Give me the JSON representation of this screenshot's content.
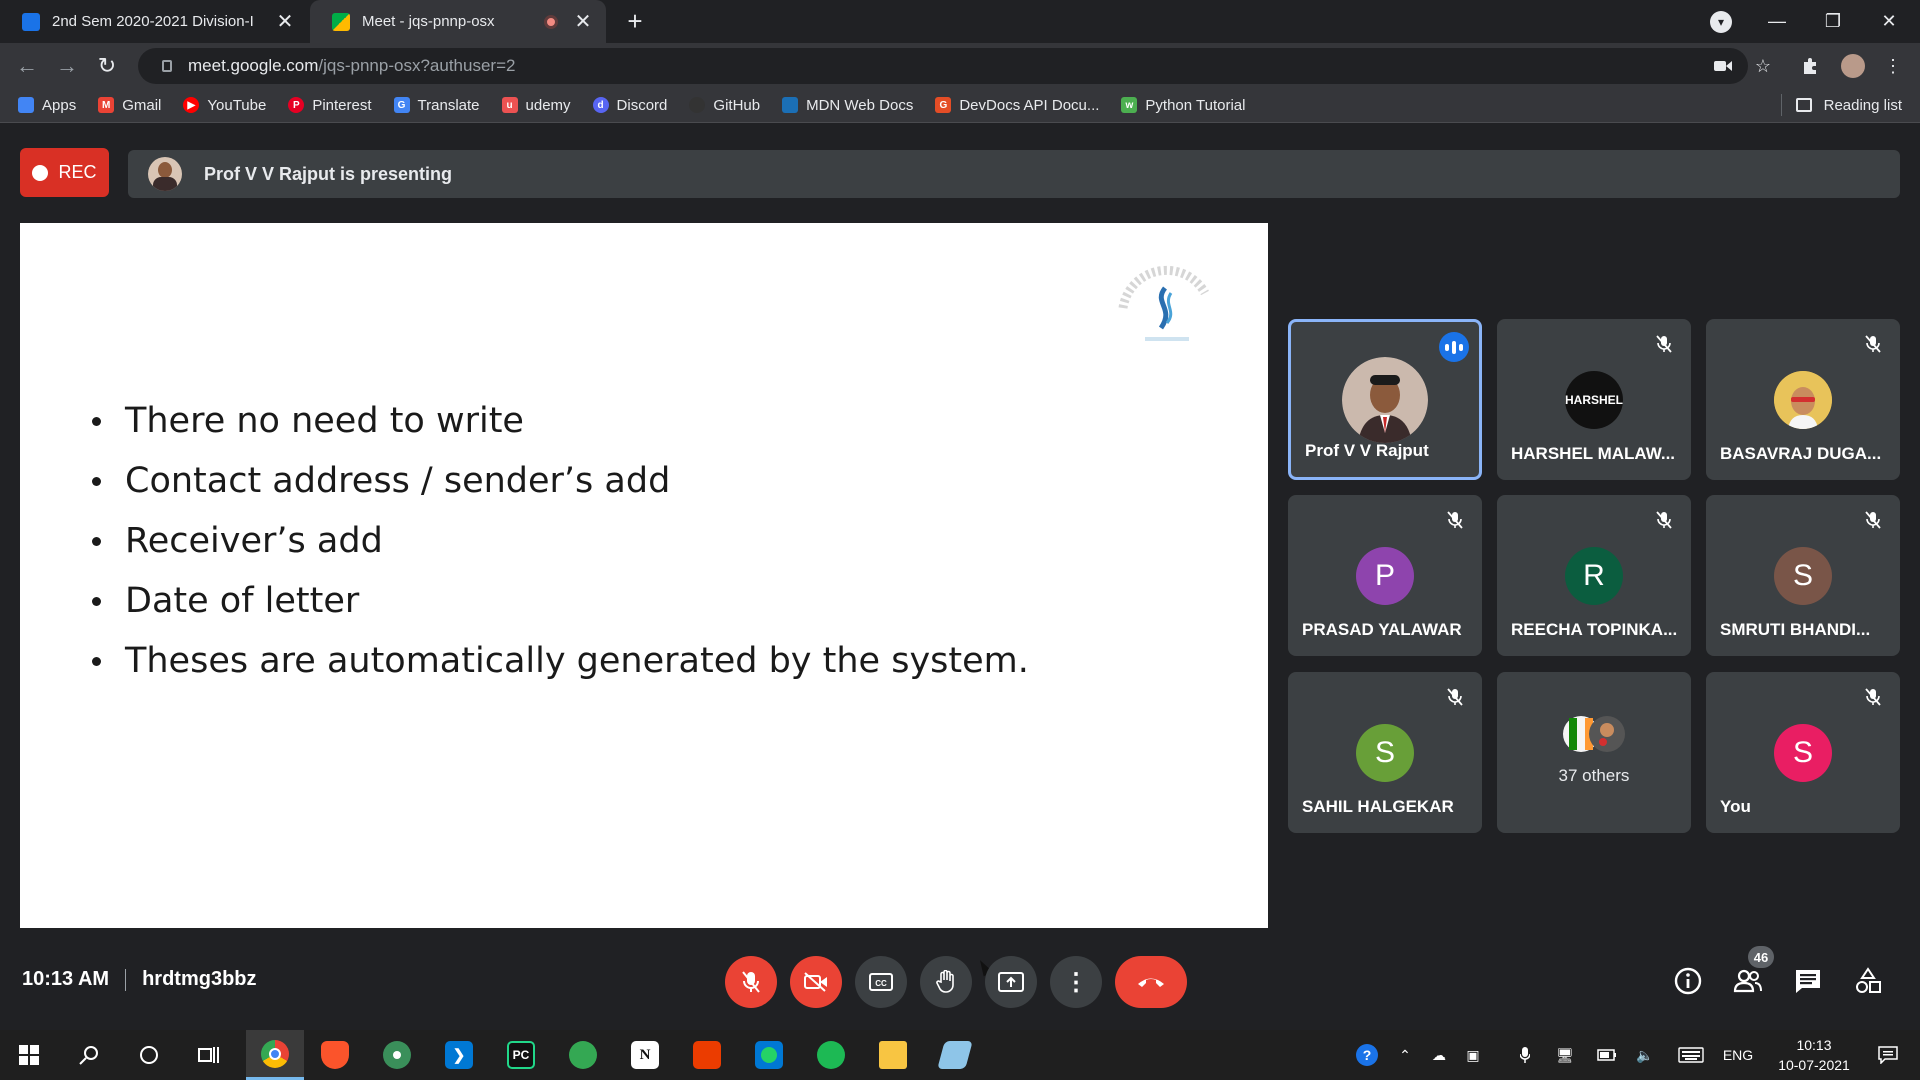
{
  "browser": {
    "tabs": [
      {
        "title": "2nd Sem 2020-2021 Division-I",
        "close": "✕"
      },
      {
        "title": "Meet - jqs-pnnp-osx",
        "close": "✕"
      }
    ],
    "new_tab": "+",
    "url_host": "meet.google.com",
    "url_path": "/jqs-pnnp-osx?authuser=2",
    "bookmarks": [
      {
        "label": "Apps",
        "icon": "apps-grid-icon",
        "color": "#4285f4"
      },
      {
        "label": "Gmail",
        "icon": "gmail-icon",
        "color": "#ea4335"
      },
      {
        "label": "YouTube",
        "icon": "youtube-icon",
        "color": "#ff0000"
      },
      {
        "label": "Pinterest",
        "icon": "pinterest-icon",
        "color": "#e60023"
      },
      {
        "label": "Translate",
        "icon": "translate-icon",
        "color": "#4285f4"
      },
      {
        "label": "udemy",
        "icon": "udemy-icon",
        "color": "#ec5252"
      },
      {
        "label": "Discord",
        "icon": "discord-icon",
        "color": "#5865f2"
      },
      {
        "label": "GitHub",
        "icon": "github-icon",
        "color": "#333333"
      },
      {
        "label": "MDN Web Docs",
        "icon": "mdn-icon",
        "color": "#1b6fb5"
      },
      {
        "label": "DevDocs API Docu...",
        "icon": "devdocs-icon",
        "color": "#e44d26"
      },
      {
        "label": "Python Tutorial",
        "icon": "w3schools-icon",
        "color": "#4caf50"
      }
    ],
    "reading_list": "Reading list"
  },
  "meet": {
    "rec_label": "REC",
    "presenting_text": "Prof V V Rajput is presenting",
    "slide_bullets": [
      "There no need to write",
      "Contact address / sender’s add",
      "Receiver’s add",
      "Date of letter",
      "Theses are automatically generated by the system."
    ],
    "participants": [
      {
        "name": "Prof V V Rajput",
        "initial": "",
        "color": "#5f6368",
        "speaking": true
      },
      {
        "name": "HARSHEL MALAW...",
        "initial": "HARSHEL",
        "color": "#111111",
        "muted": true
      },
      {
        "name": "BASAVRAJ DUGA...",
        "initial": "",
        "color": "#e0b24a",
        "muted": true
      },
      {
        "name": "PRASAD YALAWAR",
        "initial": "P",
        "color": "#8e44ad",
        "muted": true
      },
      {
        "name": "REECHA TOPINKA...",
        "initial": "R",
        "color": "#0b5d3f",
        "muted": true
      },
      {
        "name": "SMRUTI BHANDI...",
        "initial": "S",
        "color": "#795548",
        "muted": true
      },
      {
        "name": "SAHIL HALGEKAR",
        "initial": "S",
        "color": "#689f38",
        "muted": true
      },
      {
        "name": "37 others",
        "initial": "",
        "color": "#3c4043"
      },
      {
        "name": "You",
        "initial": "S",
        "color": "#e91e63",
        "muted": true
      }
    ],
    "time": "10:13 AM",
    "meeting_code": "hrdtmg3bbz",
    "people_count": "46"
  },
  "taskbar": {
    "apps": [
      {
        "name": "chrome",
        "label": ""
      },
      {
        "name": "brave",
        "label": ""
      },
      {
        "name": "atom",
        "label": ""
      },
      {
        "name": "vscode",
        "label": ""
      },
      {
        "name": "pycharm",
        "label": "PC"
      },
      {
        "name": "maps",
        "label": ""
      },
      {
        "name": "notion",
        "label": "N"
      },
      {
        "name": "office",
        "label": ""
      },
      {
        "name": "whatsapp",
        "label": ""
      },
      {
        "name": "spotify",
        "label": ""
      },
      {
        "name": "file-explorer",
        "label": ""
      },
      {
        "name": "app",
        "label": ""
      }
    ],
    "language": "ENG",
    "clock_time": "10:13",
    "clock_date": "10-07-2021"
  }
}
